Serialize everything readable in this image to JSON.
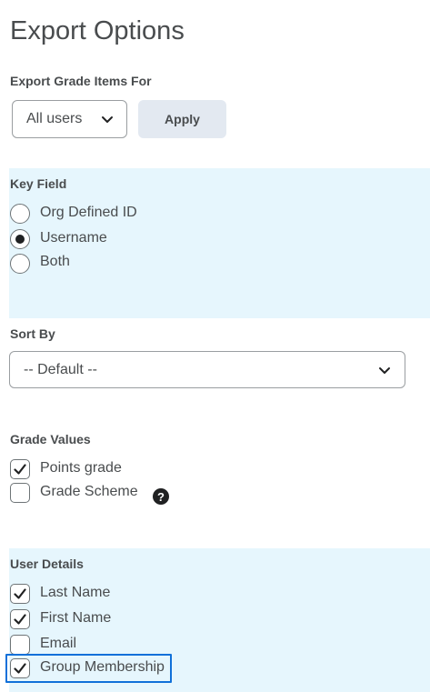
{
  "page": {
    "title": "Export Options"
  },
  "export_for": {
    "label": "Export Grade Items For",
    "selected": "All users",
    "apply_label": "Apply"
  },
  "key_field": {
    "label": "Key Field",
    "options": [
      {
        "label": "Org Defined ID",
        "selected": false
      },
      {
        "label": "Username",
        "selected": true
      },
      {
        "label": "Both",
        "selected": false
      }
    ]
  },
  "sort_by": {
    "label": "Sort By",
    "selected": "-- Default --"
  },
  "grade_values": {
    "label": "Grade Values",
    "options": [
      {
        "label": "Points grade",
        "checked": true
      },
      {
        "label": "Grade Scheme",
        "checked": false
      }
    ],
    "help_glyph": "?"
  },
  "user_details": {
    "label": "User Details",
    "options": [
      {
        "label": "Last Name",
        "checked": true
      },
      {
        "label": "First Name",
        "checked": true
      },
      {
        "label": "Email",
        "checked": false
      },
      {
        "label": "Group Membership",
        "checked": true
      }
    ]
  },
  "colors": {
    "band": "#e6f6fd",
    "focus": "#1070d9",
    "text": "#494c4e",
    "button": "#e3e9f1"
  },
  "icons": {
    "select_chevron": "chevron-down-icon",
    "check": "checkmark-icon",
    "help": "help-icon"
  }
}
